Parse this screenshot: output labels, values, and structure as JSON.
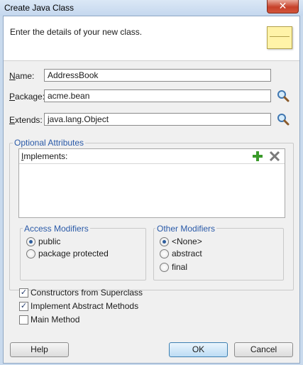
{
  "window": {
    "title": "Create Java Class",
    "close_glyph": "✕"
  },
  "header": {
    "text": "Enter the details of your new class.",
    "icon": "java-class-icon"
  },
  "form": {
    "name_label": "Name:",
    "name_value": "AddressBook",
    "package_label": "Package:",
    "package_value": "acme.bean",
    "extends_label": "Extends:",
    "extends_value": "java.lang.Object"
  },
  "optional": {
    "legend": "Optional Attributes",
    "implements_label": "Implements:"
  },
  "access": {
    "legend": "Access Modifiers",
    "options": [
      {
        "label": "public",
        "selected": true
      },
      {
        "label": "package protected",
        "selected": false
      }
    ]
  },
  "other": {
    "legend": "Other Modifiers",
    "options": [
      {
        "label": "<None>",
        "selected": true
      },
      {
        "label": "abstract",
        "selected": false
      },
      {
        "label": "final",
        "selected": false
      }
    ]
  },
  "checkboxes": [
    {
      "label": "Constructors from Superclass",
      "checked": true
    },
    {
      "label": "Implement Abstract Methods",
      "checked": true
    },
    {
      "label": "Main Method",
      "checked": false
    }
  ],
  "buttons": {
    "help": "Help",
    "ok": "OK",
    "cancel": "Cancel"
  },
  "colors": {
    "legend": "#2a5aa8",
    "add_icon": "#3a9a2a",
    "delete_icon": "#7a7a7a"
  }
}
